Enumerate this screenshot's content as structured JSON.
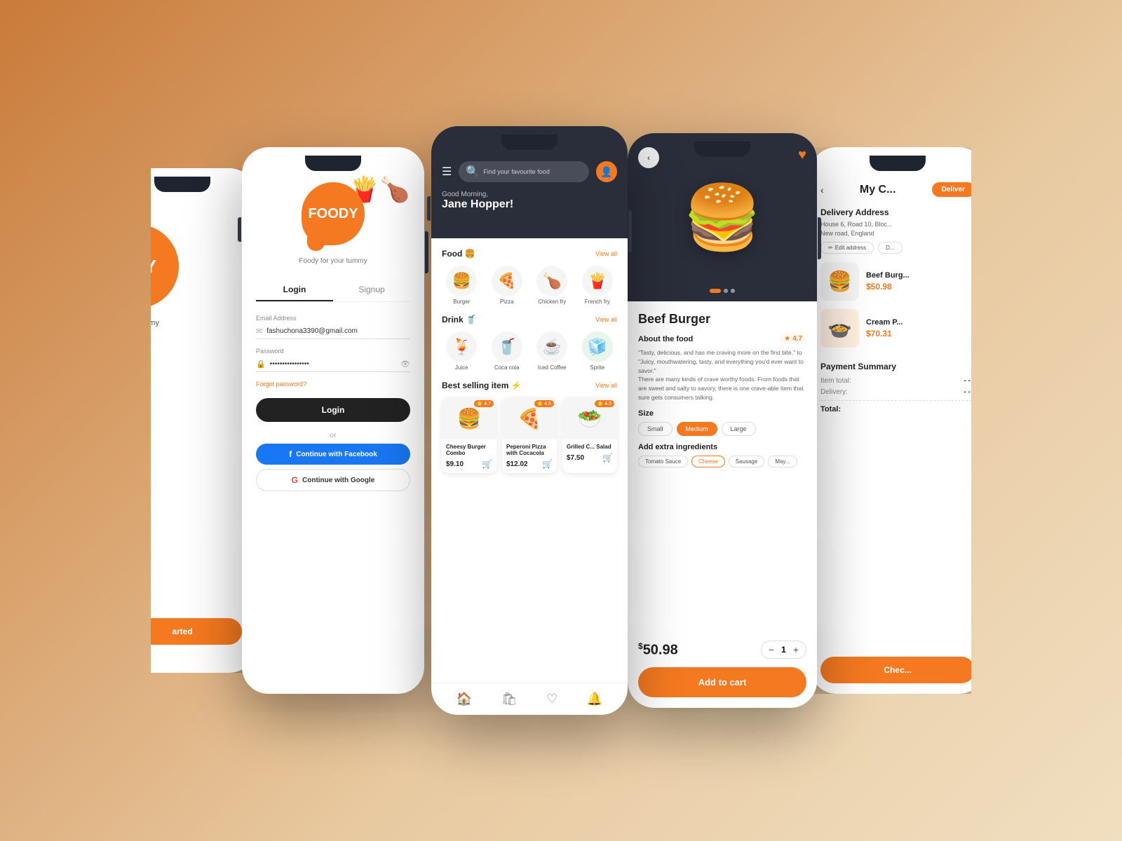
{
  "background": "#d4915a",
  "phones": {
    "phone1": {
      "type": "splash_partial",
      "logo": "ODY",
      "tagline": "our tummy",
      "started_btn": "arted"
    },
    "phone2": {
      "type": "login",
      "logo": "FOODY",
      "tagline": "Foody for your tummy",
      "tab_login": "Login",
      "tab_signup": "Signup",
      "email_label": "Email Address",
      "email_value": "fashuchona3390@gmail.com",
      "password_label": "Password",
      "password_value": "••••••••••••••••",
      "forgot_link": "Forgot password?",
      "login_btn": "Login",
      "or_text": "or",
      "facebook_btn": "Continue with Facebook",
      "google_btn": "Continue with Google"
    },
    "phone3": {
      "type": "home",
      "search_placeholder": "Find your favourite food",
      "greeting": "Good Morning,",
      "user_name": "Jane Hopper!",
      "food_section_title": "Food 🍔",
      "view_all": "View all",
      "food_items": [
        {
          "name": "Burger",
          "emoji": "🍔"
        },
        {
          "name": "Pizza",
          "emoji": "🍕"
        },
        {
          "name": "Chicken fry",
          "emoji": "🍗"
        },
        {
          "name": "French fry",
          "emoji": "🍟"
        }
      ],
      "drink_section_title": "Drink 🥤",
      "drink_items": [
        {
          "name": "Juice",
          "emoji": "🍹"
        },
        {
          "name": "Coca cola",
          "emoji": "🥤"
        },
        {
          "name": "Iced Coffee",
          "emoji": "☕"
        },
        {
          "name": "Sprite",
          "emoji": "🧊"
        }
      ],
      "best_section_title": "Best selling item ⚡",
      "best_items": [
        {
          "name": "Cheesy Burger Combo",
          "price": "$9.10",
          "emoji": "🍔",
          "rating": "4.7"
        },
        {
          "name": "Peperoni Pizza with Cocacola",
          "price": "$12.02",
          "emoji": "🍕",
          "rating": "4.5"
        },
        {
          "name": "Grilled C... Salad",
          "price": "$7.50",
          "emoji": "🥗",
          "rating": "4.5"
        }
      ]
    },
    "phone4": {
      "type": "product",
      "product_name": "Beef Burger",
      "about_title": "About the food",
      "rating": "4.7",
      "description": "\"Tasty, delicious, and has me craving more on the first bite.\" to \"Juicy, mouthwatering, tasty, and everything you'd ever want to savor.\"\nThere are many kinds of crave worthy foods. From foods that are sweet and salty to savory, there is one crave-able item that sure gets consumers talking.",
      "size_title": "Size",
      "sizes": [
        "Small",
        "Medium",
        "Large"
      ],
      "selected_size": "Medium",
      "extras_title": "Add extra ingredients",
      "extras": [
        "Tomato Sauce",
        "Cheese",
        "Sausage",
        "May..."
      ],
      "selected_extras": [
        "Cheese"
      ],
      "price": "50.98",
      "price_currency": "$",
      "qty": "1",
      "add_to_cart": "Add to cart",
      "emoji": "🍔"
    },
    "phone5": {
      "type": "cart",
      "title": "My C...",
      "deliver_btn": "Deliver",
      "delivery_section_title": "Delivery Address",
      "address_line1": "House 6, Road 10, Bloc...",
      "address_line2": "New road, England",
      "edit_address_btn": "Edit address",
      "delete_btn": "D...",
      "cart_items": [
        {
          "name": "Beef Burg...",
          "price": "$50.98",
          "emoji": "🍔"
        },
        {
          "name": "Cream P...",
          "price": "$70.31",
          "emoji": "🍲"
        }
      ],
      "payment_title": "Payment Summary",
      "item_total_label": "Item total:",
      "delivery_label": "Delivery:",
      "total_label": "Total:",
      "checkout_btn": "Chec..."
    }
  }
}
